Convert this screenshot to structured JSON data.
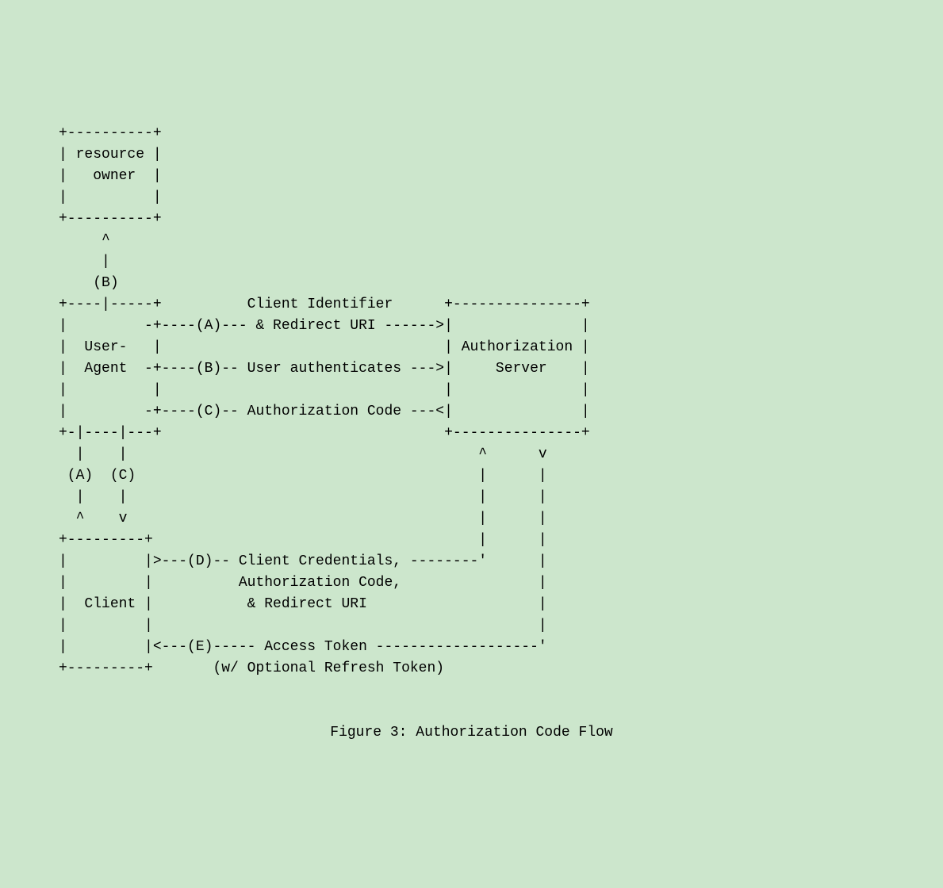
{
  "diagram": {
    "line01": "     +----------+",
    "line02": "     | resource |",
    "line03": "     |   owner  |",
    "line04": "     |          |",
    "line05": "     +----------+",
    "line06": "          ^",
    "line07": "          |",
    "line08": "         (B)",
    "line09": "     +----|-----+          Client Identifier      +---------------+",
    "line10": "     |         -+----(A)--- & Redirect URI ------>|               |",
    "line11": "     |  User-   |                                 | Authorization |",
    "line12": "     |  Agent  -+----(B)-- User authenticates --->|     Server    |",
    "line13": "     |          |                                 |               |",
    "line14": "     |         -+----(C)-- Authorization Code ---<|               |",
    "line15": "     +-|----|---+                                 +---------------+",
    "line16": "       |    |                                         ^      v",
    "line17": "      (A)  (C)                                        |      |",
    "line18": "       |    |                                         |      |",
    "line19": "       ^    v                                         |      |",
    "line20": "     +---------+                                      |      |",
    "line21": "     |         |>---(D)-- Client Credentials, --------'      |",
    "line22": "     |         |          Authorization Code,                |",
    "line23": "     |  Client |           & Redirect URI                    |",
    "line24": "     |         |                                             |",
    "line25": "     |         |<---(E)----- Access Token -------------------'",
    "line26": "     +---------+       (w/ Optional Refresh Token)"
  },
  "caption": "Figure 3: Authorization Code Flow"
}
